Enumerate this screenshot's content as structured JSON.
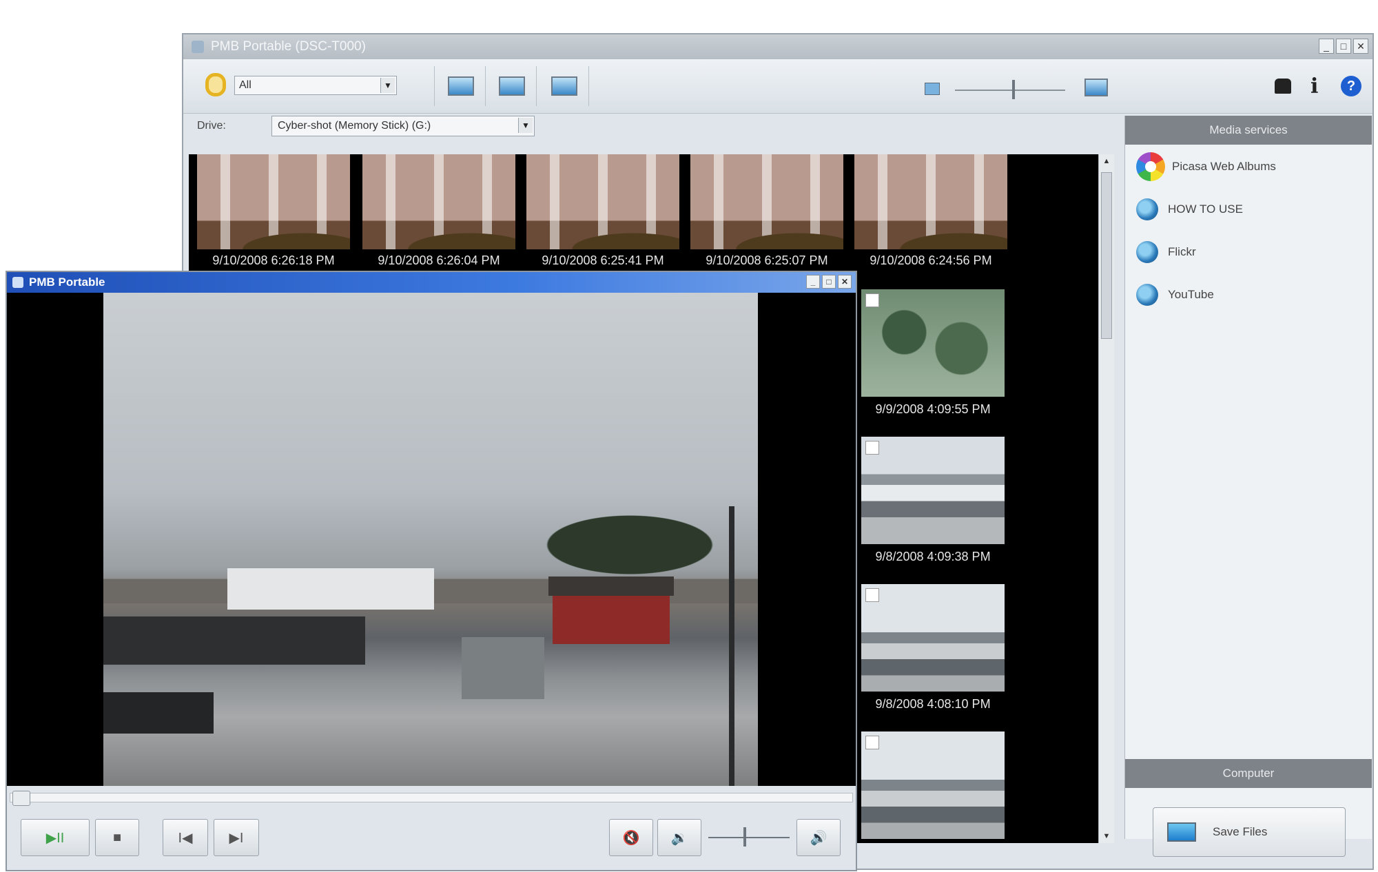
{
  "main_window": {
    "title": "PMB Portable (DSC-T000)",
    "window_controls": [
      "_",
      "□",
      "✕"
    ],
    "toolbar": {
      "filter_value": "All",
      "icons": [
        "folder-icon",
        "import-photo-icon",
        "export-photo-icon",
        "slideshow-icon",
        "zoom-small-icon",
        "zoom-large-icon",
        "lock-icon",
        "info-icon",
        "help-icon"
      ],
      "info_glyph": "i",
      "help_glyph": "?"
    },
    "drive": {
      "label": "Drive:",
      "value": "Cyber-shot (Memory Stick) (G:)"
    },
    "thumbnails_top": [
      {
        "date": "9/10/2008 6:26:18 PM"
      },
      {
        "date": "9/10/2008 6:26:04 PM"
      },
      {
        "date": "9/10/2008 6:25:41 PM"
      },
      {
        "date": "9/10/2008 6:25:07 PM"
      },
      {
        "date": "9/10/2008 6:24:56 PM"
      }
    ],
    "thumbnails_column": [
      {
        "date": "9/9/2008 4:09:55 PM"
      },
      {
        "date": "9/8/2008 4:09:38 PM"
      },
      {
        "date": "9/8/2008 4:08:10 PM"
      },
      {
        "date": ""
      }
    ],
    "side_panel": {
      "media_services_header": "Media services",
      "services": [
        {
          "label": "Picasa Web Albums",
          "icon": "picasa-icon"
        },
        {
          "label": "HOW TO USE",
          "icon": "globe-icon"
        },
        {
          "label": "Flickr",
          "icon": "globe-icon"
        },
        {
          "label": "YouTube",
          "icon": "globe-icon"
        }
      ],
      "computer_header": "Computer",
      "save_files_label": "Save Files"
    }
  },
  "player_window": {
    "title": "PMB Portable",
    "window_controls": [
      "_",
      "□",
      "✕"
    ],
    "seek_progress": 0.0,
    "volume_level": 0.45,
    "buttons": {
      "play_pause": "▶II",
      "stop": "■",
      "prev": "I◀",
      "next": "▶I",
      "mute": "🔇",
      "vol_down": "🔉",
      "vol_up": "🔊"
    }
  }
}
